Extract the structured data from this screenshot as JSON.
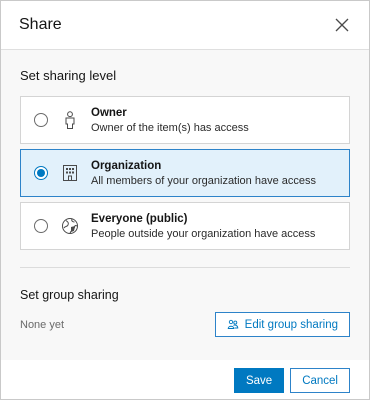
{
  "dialog": {
    "title": "Share",
    "close_icon": "close-icon"
  },
  "sharing_level": {
    "heading": "Set sharing level",
    "selected": "organization",
    "options": [
      {
        "id": "owner",
        "title": "Owner",
        "description": "Owner of the item(s) has access",
        "icon": "user-icon"
      },
      {
        "id": "organization",
        "title": "Organization",
        "description": "All members of your organization have access",
        "icon": "organization-building-icon"
      },
      {
        "id": "everyone",
        "title": "Everyone (public)",
        "description": "People outside your organization have access",
        "icon": "globe-icon"
      }
    ]
  },
  "group_sharing": {
    "heading": "Set group sharing",
    "status": "None yet",
    "edit_label": "Edit group sharing",
    "edit_icon": "group-icon"
  },
  "footer": {
    "save_label": "Save",
    "cancel_label": "Cancel"
  },
  "colors": {
    "accent": "#0079c1",
    "selected_background": "#e2f1fb"
  }
}
